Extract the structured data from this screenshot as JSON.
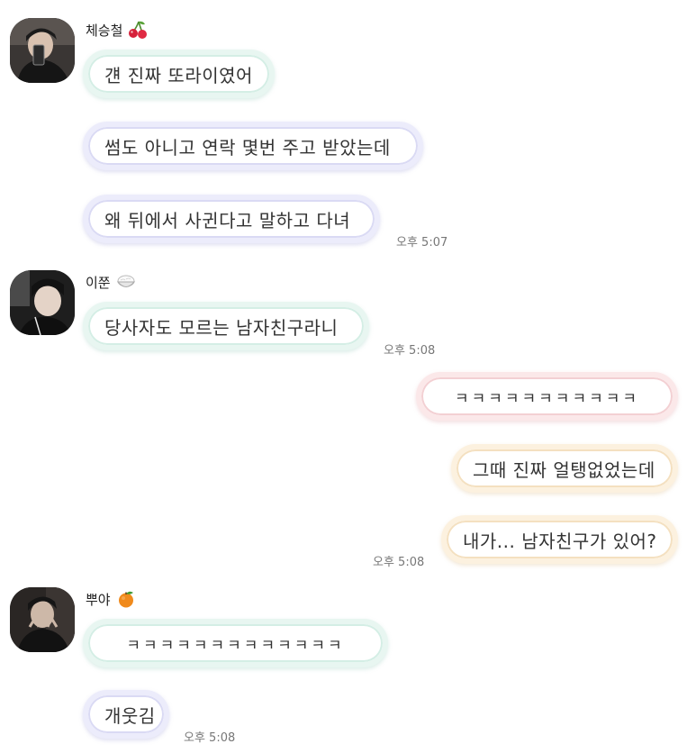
{
  "messages": {
    "group1": {
      "sender": "체승철",
      "emoji": "cherry-icon",
      "lines": [
        "걘 진짜 또라이였어",
        "썸도 아니고 연락 몇번 주고 받았는데",
        "왜 뒤에서 사귄다고 말하고 다녀"
      ],
      "time": "오후 5:07"
    },
    "group2": {
      "sender": "이쭌",
      "emoji": "rice-bowl-icon",
      "lines": [
        "당사자도 모르는 남자친구라니"
      ],
      "time": "오후 5:08"
    },
    "mine": {
      "lines": [
        "ㅋㅋㅋㅋㅋㅋㅋㅋㅋㅋㅋ",
        "그때 진짜 얼탱없었는데",
        "내가... 남자친구가 있어?"
      ],
      "time": "오후 5:08"
    },
    "group3": {
      "sender": "뿌야",
      "emoji": "tangerine-icon",
      "lines": [
        "ㅋㅋㅋㅋㅋㅋㅋㅋㅋㅋㅋㅋㅋ",
        "개웃김"
      ],
      "time": "오후 5:08"
    }
  },
  "colors": {
    "mint_border": "#e8f6f1",
    "lavender_border": "#ececfb",
    "pink_border": "#fbe8e9",
    "peach_border": "#fcf1df"
  }
}
